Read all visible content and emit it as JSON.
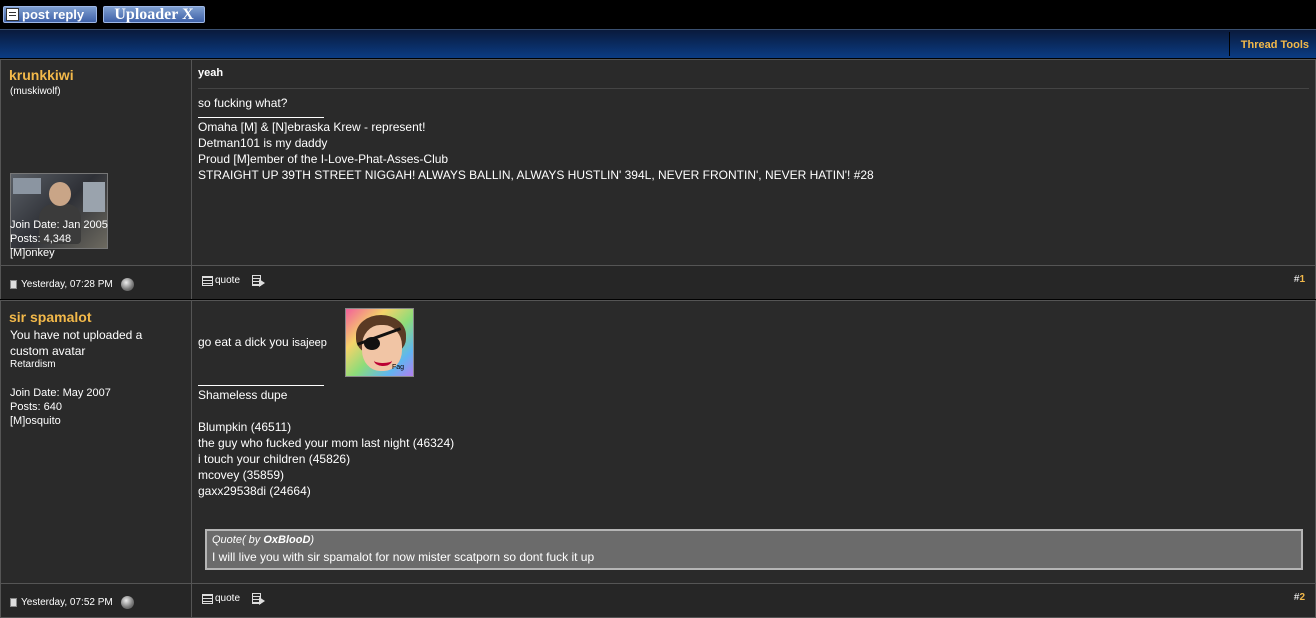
{
  "toolbar": {
    "post_reply_label": "post reply",
    "uploader_label": "Uploader X"
  },
  "thread": {
    "tools_label": "Thread Tools"
  },
  "posts": [
    {
      "username": "krunkkiwi",
      "user_subtitle": "(muskiwolf)",
      "join_date": "Join Date: Jan 2005",
      "posts_count": "Posts: 4,348",
      "group": "[M]onkey",
      "title": "yeah",
      "body": "so fucking what?",
      "signature": [
        "Omaha [M] & [N]ebraska Krew - represent!",
        "Detman101 is my daddy",
        "Proud [M]ember of the I-Love-Phat-Asses-Club",
        "STRAIGHT UP 39TH STREET NIGGAH! ALWAYS BALLIN, ALWAYS HUSTLIN' 394L, NEVER FRONTIN', NEVER HATIN'! #28"
      ],
      "datetime": "Yesterday, 07:28 PM",
      "quote_label": "quote",
      "post_number_prefix": "#",
      "post_number": "1"
    },
    {
      "username": "sir spamalot",
      "avatar_text": "You have not uploaded a custom avatar",
      "user_title": "Retardism",
      "join_date": "Join Date: May 2007",
      "posts_count": "Posts: 640",
      "group": "[M]osquito",
      "body_prefix": "go eat a dick you ",
      "body_suffix": "isajeep",
      "image_tag": "Fag",
      "signature": [
        "Shameless dupe",
        "",
        "Blumpkin (46511)",
        "the guy who fucked your mom last night (46324)",
        "i touch your children (45826)",
        "mcovey (35859)",
        "gaxx29538di (24664)"
      ],
      "quote_header_prefix": "Quote( by ",
      "quote_author": "OxBlooD",
      "quote_header_suffix": ")",
      "quote_text": "I will live you with sir spamalot for now mister scatporn so dont fuck it up",
      "datetime": "Yesterday, 07:52 PM",
      "quote_label": "quote",
      "post_number_prefix": "#",
      "post_number": "2"
    }
  ],
  "colors": {
    "accent": "#f3b94a",
    "header_blue": "#0b3c84",
    "post_bg": "#2a2a2a"
  }
}
